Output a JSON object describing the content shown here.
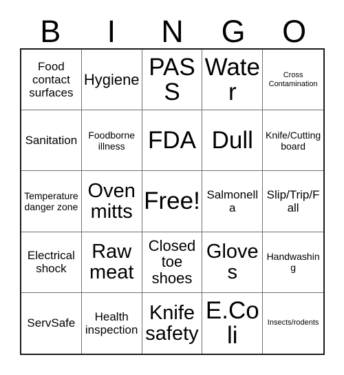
{
  "header": {
    "letters": [
      "B",
      "I",
      "N",
      "G",
      "O"
    ]
  },
  "grid": {
    "columns": 5,
    "rows": 5,
    "cells": [
      {
        "text": "Food\ncontact\nsurfaces",
        "size": "md"
      },
      {
        "text": "Hygiene",
        "size": "lg"
      },
      {
        "text": "PASS",
        "size": "xxl"
      },
      {
        "text": "Water",
        "size": "xxl"
      },
      {
        "text": "Cross\nContamination",
        "size": "xs"
      },
      {
        "text": "Sanitation",
        "size": "md"
      },
      {
        "text": "Foodborne\nillness",
        "size": "sm"
      },
      {
        "text": "FDA",
        "size": "xxl"
      },
      {
        "text": "Dull",
        "size": "xxl"
      },
      {
        "text": "Knife/Cutting\nboard",
        "size": "sm"
      },
      {
        "text": "Temperature\ndanger zone",
        "size": "sm"
      },
      {
        "text": "Oven\nmitts",
        "size": "xl"
      },
      {
        "text": "Free!",
        "size": "xxl"
      },
      {
        "text": "Salmonella",
        "size": "md"
      },
      {
        "text": "Slip/Trip/Fall",
        "size": "md"
      },
      {
        "text": "Electrical\nshock",
        "size": "md"
      },
      {
        "text": "Raw\nmeat",
        "size": "xl"
      },
      {
        "text": "Closed\ntoe\nshoes",
        "size": "lg"
      },
      {
        "text": "Gloves",
        "size": "xl"
      },
      {
        "text": "Handwashing",
        "size": "sm"
      },
      {
        "text": "ServSafe",
        "size": "md"
      },
      {
        "text": "Health\ninspection",
        "size": "md"
      },
      {
        "text": "Knife\nsafety",
        "size": "xl"
      },
      {
        "text": "E.Coli",
        "size": "xxl"
      },
      {
        "text": "Insects/rodents",
        "size": "xs"
      }
    ]
  },
  "colors": {
    "outer_border": "#1a1a1a",
    "inner_border": "#6e6e6e",
    "background": "#ffffff",
    "text": "#000000"
  }
}
